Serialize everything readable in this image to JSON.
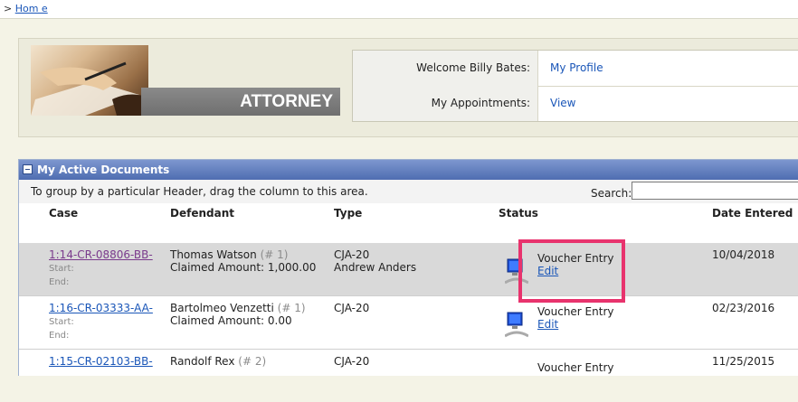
{
  "breadcrumb": {
    "prefix": ">",
    "home": "Hom e"
  },
  "header": {
    "logo_text": "ATTORNEY",
    "welcome_label": "Welcome Billy Bates:",
    "profile_link": "My Profile",
    "appointments_label": "My Appointments:",
    "appointments_link": "View"
  },
  "docs": {
    "title": "My Active Documents",
    "group_hint": "To group by a particular Header, drag the column to this area.",
    "search_label": "Search:",
    "search_value": "",
    "columns": [
      "Case",
      "Defendant",
      "Type",
      "Status",
      "Date Entered"
    ],
    "start_label": "Start:",
    "end_label": "End:",
    "rows": [
      {
        "case": "1:14-CR-08806-BB-",
        "defendant": "Thomas Watson",
        "defendant_num": "(# 1)",
        "claimed": "Claimed Amount: 1,000.00",
        "type": "CJA-20",
        "type_sub": "Andrew Anders",
        "status": "Voucher Entry",
        "status_link": "Edit",
        "date": "10/04/2018"
      },
      {
        "case": "1:16-CR-03333-AA-",
        "defendant": "Bartolmeo Venzetti",
        "defendant_num": "(# 1)",
        "claimed": "Claimed Amount: 0.00",
        "type": "CJA-20",
        "type_sub": "",
        "status": "Voucher Entry",
        "status_link": "Edit",
        "date": "02/23/2016"
      },
      {
        "case": "1:15-CR-02103-BB-",
        "defendant": "Randolf Rex",
        "defendant_num": "(# 2)",
        "claimed": "",
        "type": "CJA-20",
        "type_sub": "",
        "status": "Voucher Entry",
        "status_link": "",
        "date": "11/25/2015"
      }
    ]
  },
  "colors": {
    "highlight": "#e8336d",
    "title_bar": "#4f6db1",
    "link": "#1a56b8"
  }
}
